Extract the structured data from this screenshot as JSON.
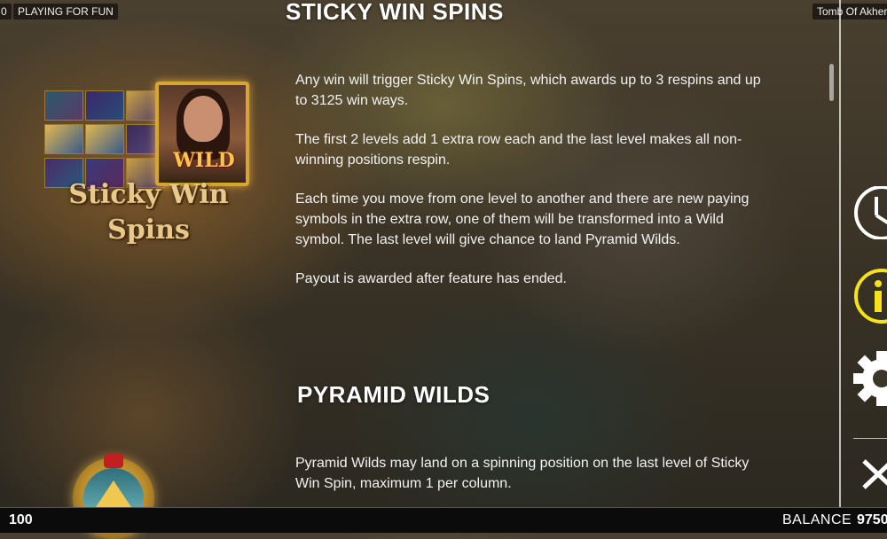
{
  "top_bar": {
    "left_edge_text": "0",
    "mode_badge": "PLAYING FOR FUN",
    "game_title": "Tomb Of Akher"
  },
  "sections": [
    {
      "title": "STICKY WIN SPINS",
      "paragraphs": [
        "Any win will trigger Sticky Win Spins, which awards up to 3 respins and up to 3125 win ways.",
        "The first 2 levels add 1 extra row each and the last level makes all non-winning positions respin.",
        "Each time you move from one level to another and there are new paying symbols in the extra row, one of them will be transformed into a Wild symbol. The last level will give chance to land Pyramid Wilds.",
        "Payout is awarded after feature has ended."
      ],
      "image_text": {
        "wild": "WILD",
        "line1": "Sticky Win",
        "line2": "Spins"
      }
    },
    {
      "title": "PYRAMID WILDS",
      "paragraphs": [
        "Pyramid Wilds may land on a spinning position on the last level of Sticky Win Spin, maximum 1 per column."
      ]
    }
  ],
  "side_menu": {
    "icons": [
      "clock-icon",
      "info-icon",
      "gear-icon",
      "close-icon"
    ],
    "active": "info-icon",
    "accent_color": "#f5e21b"
  },
  "bottom_bar": {
    "bet_value": "100",
    "balance_label": "BALANCE",
    "balance_value": "9750"
  }
}
